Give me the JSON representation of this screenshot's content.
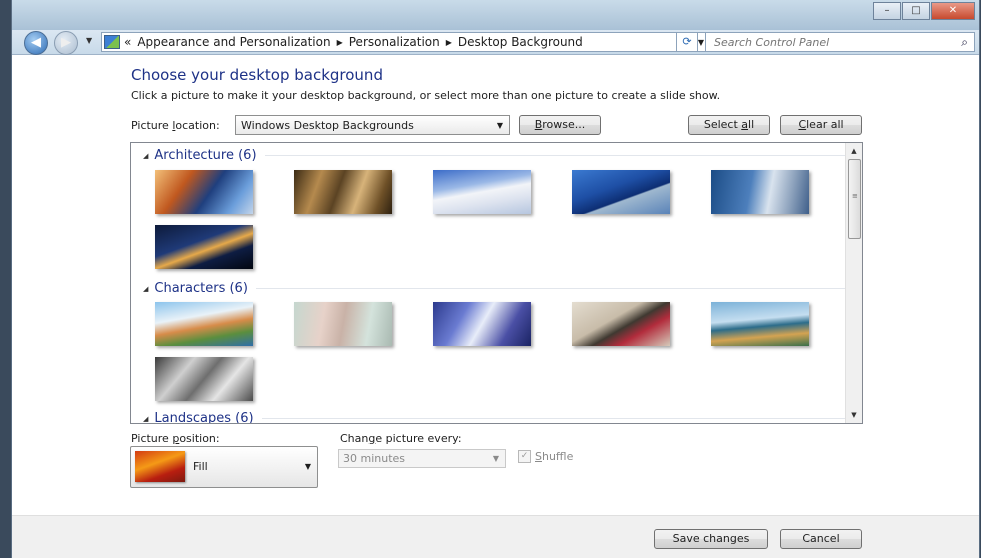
{
  "window": {
    "buttons": {
      "minimize": "–",
      "maximize": "□",
      "close": "✕"
    }
  },
  "nav": {
    "back": "◀",
    "forward": "▶",
    "history_dropdown": "▼",
    "address_prefix": "«",
    "breadcrumb": [
      "Appearance and Personalization",
      "Personalization",
      "Desktop Background"
    ],
    "separator": "▶",
    "dropdown": "▼",
    "refresh": "⟳",
    "search_placeholder": "Search Control Panel",
    "search_icon": "⌕"
  },
  "header": {
    "title": "Choose your desktop background",
    "subtitle": "Click a picture to make it your desktop background, or select more than one picture to create a slide show."
  },
  "location": {
    "label_pre": "Picture ",
    "label_ul": "l",
    "label_post": "ocation:",
    "value": "Windows Desktop Backgrounds",
    "dropdown": "▼",
    "browse_ul": "B",
    "browse_post": "rowse...",
    "select_all_pre": "Select ",
    "select_all_ul": "a",
    "select_all_post": "ll",
    "clear_all_ul": "C",
    "clear_all_post": "lear all"
  },
  "groups": {
    "architecture": {
      "label": "Architecture (6)",
      "toggle": "◢"
    },
    "characters": {
      "label": "Characters (6)",
      "toggle": "◢"
    },
    "landscapes": {
      "label": "Landscapes (6)",
      "toggle": "◢"
    }
  },
  "scrollbar": {
    "up": "▲",
    "down": "▼",
    "grip": "≡"
  },
  "position": {
    "label_pre": "Picture ",
    "label_ul": "p",
    "label_post": "osition:",
    "value": "Fill",
    "dropdown": "▼"
  },
  "interval": {
    "label_pre": "Chan",
    "label_ul": "g",
    "label_post": "e picture every:",
    "value": "30 minutes",
    "dropdown": "▼"
  },
  "shuffle": {
    "check": "✓",
    "label_ul": "S",
    "label_post": "huffle"
  },
  "footer": {
    "save": "Save changes",
    "cancel": "Cancel"
  },
  "colors": {
    "heading": "#1e3287",
    "window_bg": "#ffffff",
    "footer_bg": "#f0f0f0"
  }
}
